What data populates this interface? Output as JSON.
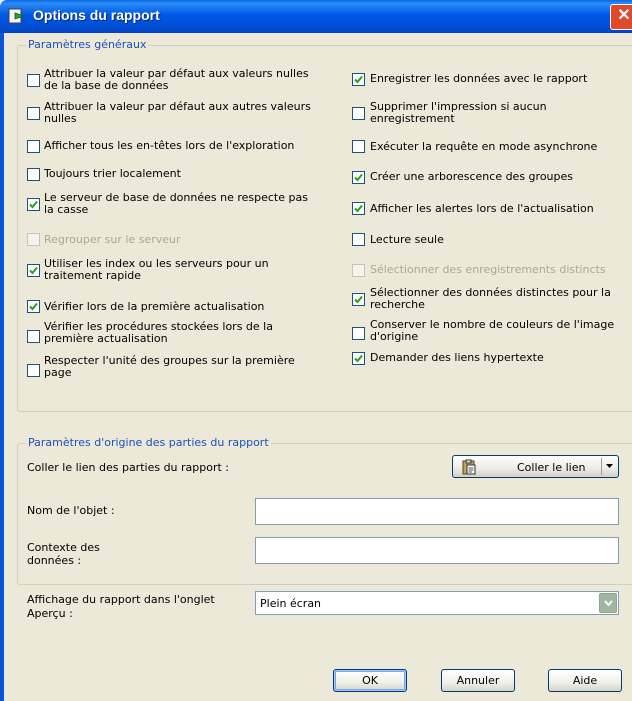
{
  "window": {
    "title": "Options du rapport",
    "close_glyph": "✕"
  },
  "general": {
    "legend": "Paramètres généraux",
    "left": [
      {
        "lines": [
          "Attribuer la valeur par défaut aux valeurs nulles",
          "de la base de données"
        ],
        "checked": false,
        "disabled": false
      },
      {
        "lines": [
          "Attribuer la valeur par défaut aux autres valeurs",
          "nulles"
        ],
        "checked": false,
        "disabled": false
      },
      {
        "lines": [
          "Afficher tous les en-têtes lors de l'exploration"
        ],
        "checked": false,
        "disabled": false
      },
      {
        "lines": [
          "Toujours trier localement"
        ],
        "checked": false,
        "disabled": false
      },
      {
        "lines": [
          "Le serveur de base de données ne respecte pas",
          "la casse"
        ],
        "checked": true,
        "disabled": false
      },
      {
        "lines": [
          "Regrouper sur le serveur"
        ],
        "checked": false,
        "disabled": true
      },
      {
        "lines": [
          "Utiliser les index ou les serveurs pour un",
          "traitement rapide"
        ],
        "checked": true,
        "disabled": false
      },
      {
        "lines": [
          "Vérifier lors de la première actualisation"
        ],
        "checked": true,
        "disabled": false
      },
      {
        "lines": [
          "Vérifier les procédures stockées lors de la",
          "première actualisation"
        ],
        "checked": false,
        "disabled": false
      },
      {
        "lines": [
          "Respecter l'unité des groupes sur la première",
          "page"
        ],
        "checked": false,
        "disabled": false
      }
    ],
    "right": [
      {
        "lines": [
          "Enregistrer les données avec le rapport"
        ],
        "checked": true,
        "disabled": false
      },
      {
        "lines": [
          "Supprimer l'impression si aucun",
          "enregistrement"
        ],
        "checked": false,
        "disabled": false
      },
      {
        "lines": [
          "Exécuter la requête en mode asynchrone"
        ],
        "checked": false,
        "disabled": false
      },
      {
        "lines": [
          "Créer une arborescence des groupes"
        ],
        "checked": true,
        "disabled": false
      },
      {
        "lines": [
          "Afficher les alertes lors de l'actualisation"
        ],
        "checked": true,
        "disabled": false
      },
      {
        "lines": [
          "Lecture seule"
        ],
        "checked": false,
        "disabled": false
      },
      {
        "lines": [
          "Sélectionner des enregistrements distincts"
        ],
        "checked": false,
        "disabled": true
      },
      {
        "lines": [
          "Sélectionner des données distinctes pour la",
          "recherche"
        ],
        "checked": true,
        "disabled": false
      },
      {
        "lines": [
          "Conserver le nombre de couleurs de l'image",
          "d'origine"
        ],
        "checked": false,
        "disabled": false
      },
      {
        "lines": [
          "Demander des liens hypertexte"
        ],
        "checked": true,
        "disabled": false
      }
    ]
  },
  "origin": {
    "legend": "Paramètres d'origine des parties du rapport",
    "paste_label": "Coller le lien des parties du rapport :",
    "paste_button": "Coller le lien",
    "object_name_label": "Nom de l'objet :",
    "object_name_value": "",
    "context_label": [
      "Contexte des",
      "données :"
    ],
    "context_value": ""
  },
  "preview": {
    "label": [
      "Affichage du rapport dans l'onglet",
      "Aperçu :"
    ],
    "selected": "Plein écran"
  },
  "buttons": {
    "ok": "OK",
    "cancel": "Annuler",
    "help": "Aide"
  },
  "colors": {
    "titlebar": "#0058e6",
    "legend_text": "#1f4ebf",
    "dialog_bg": "#ece9d8",
    "check": "#21a121"
  }
}
